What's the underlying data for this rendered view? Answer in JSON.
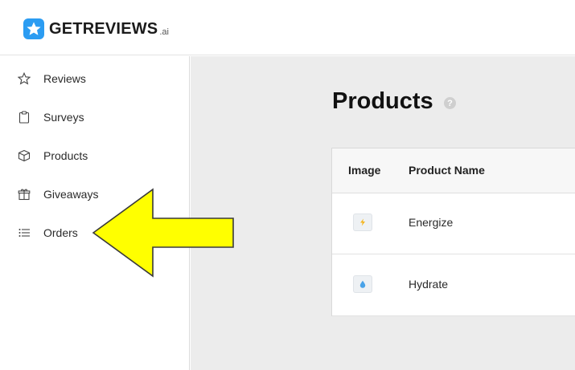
{
  "brand": {
    "name": "GETREVIEWS",
    "suffix": ".ai",
    "color": "#2b9cf2"
  },
  "sidebar": {
    "items": [
      {
        "label": "Reviews",
        "icon": "star-icon"
      },
      {
        "label": "Surveys",
        "icon": "clipboard-icon"
      },
      {
        "label": "Products",
        "icon": "box-icon"
      },
      {
        "label": "Giveaways",
        "icon": "gift-icon"
      },
      {
        "label": "Orders",
        "icon": "list-icon"
      }
    ]
  },
  "main": {
    "title": "Products",
    "help_icon": "?",
    "table": {
      "columns": [
        "Image",
        "Product Name"
      ],
      "rows": [
        {
          "name": "Energize",
          "thumb": "lightning-icon"
        },
        {
          "name": "Hydrate",
          "thumb": "droplet-icon"
        }
      ]
    }
  },
  "annotation": {
    "arrow_color": "#ffff00",
    "points_to": "Orders"
  }
}
